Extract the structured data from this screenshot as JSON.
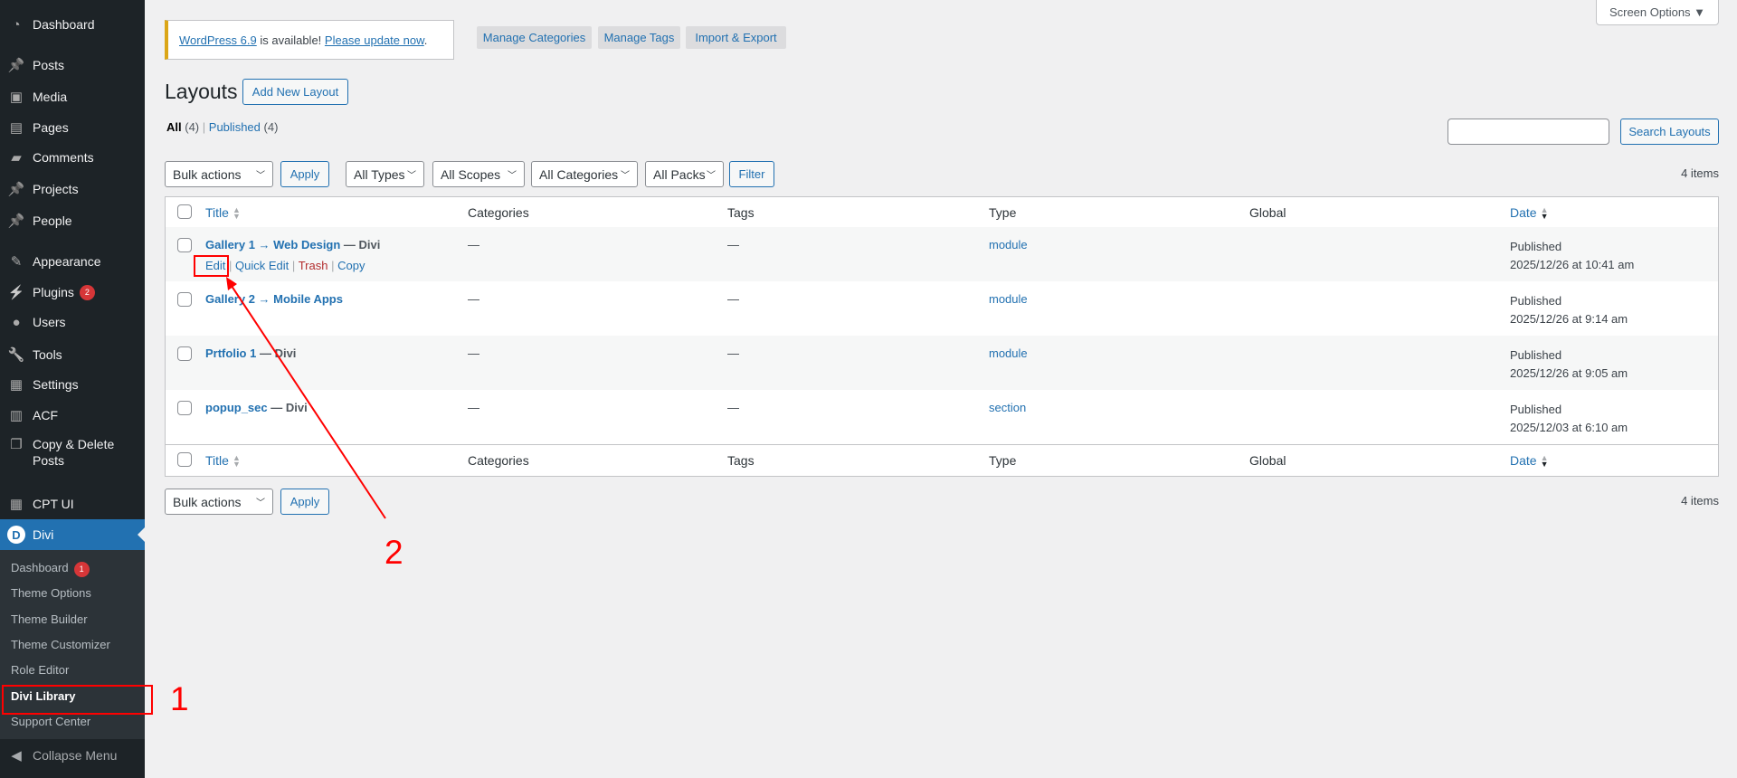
{
  "sidebar": {
    "items": [
      {
        "label": "Dashboard",
        "icon": "dashboard-icon"
      },
      {
        "label": "Posts",
        "icon": "pin-icon"
      },
      {
        "label": "Media",
        "icon": "media-icon"
      },
      {
        "label": "Pages",
        "icon": "pages-icon"
      },
      {
        "label": "Comments",
        "icon": "comment-icon"
      },
      {
        "label": "Projects",
        "icon": "pin-icon"
      },
      {
        "label": "People",
        "icon": "pin-icon"
      },
      {
        "label": "Appearance",
        "icon": "brush-icon"
      },
      {
        "label": "Plugins",
        "icon": "plugin-icon",
        "badge": "2"
      },
      {
        "label": "Users",
        "icon": "user-icon"
      },
      {
        "label": "Tools",
        "icon": "wrench-icon"
      },
      {
        "label": "Settings",
        "icon": "settings-icon"
      },
      {
        "label": "ACF",
        "icon": "acf-icon"
      },
      {
        "label": "Copy & Delete Posts",
        "icon": "copy-icon"
      },
      {
        "label": "CPT UI",
        "icon": "grid-icon"
      }
    ],
    "active": {
      "label": "Divi",
      "icon": "divi-logo-icon"
    },
    "submenu": [
      {
        "label": "Dashboard",
        "badge": "1"
      },
      {
        "label": "Theme Options"
      },
      {
        "label": "Theme Builder"
      },
      {
        "label": "Theme Customizer"
      },
      {
        "label": "Role Editor"
      },
      {
        "label": "Divi Library",
        "current": true
      },
      {
        "label": "Support Center"
      }
    ],
    "collapse": "Collapse Menu"
  },
  "notice": {
    "link1": "WordPress 6.9",
    "text": " is available! ",
    "link2": "Please update now",
    "end": "."
  },
  "top_buttons": [
    "Manage Categories",
    "Manage Tags",
    "Import & Export"
  ],
  "screen_options": "Screen Options ▼",
  "page_title": "Layouts",
  "add_new": "Add New Layout",
  "views": {
    "all": "All",
    "all_count": "(4)",
    "sep": "|",
    "published": "Published",
    "published_count": "(4)"
  },
  "search": {
    "value": "",
    "button": "Search Layouts"
  },
  "filters": {
    "bulk": "Bulk actions",
    "apply": "Apply",
    "types": "All Types",
    "scopes": "All Scopes",
    "categories": "All Categories",
    "packs": "All Packs",
    "filter": "Filter"
  },
  "item_count": "4 items",
  "columns": [
    "Title",
    "Categories",
    "Tags",
    "Type",
    "Global",
    "Date"
  ],
  "row_actions": {
    "edit": "Edit",
    "quick_edit": "Quick Edit",
    "trash": "Trash",
    "copy": "Copy"
  },
  "rows": [
    {
      "title": "Gallery 1 → Web Design",
      "suffix": " — Divi",
      "categories": "—",
      "tags": "—",
      "type": "module",
      "global": "",
      "status": "Published",
      "date": "2025/12/26 at 10:41 am"
    },
    {
      "title": "Gallery 2 → Mobile Apps",
      "suffix": "",
      "categories": "—",
      "tags": "—",
      "type": "module",
      "global": "",
      "status": "Published",
      "date": "2025/12/26 at 9:14 am"
    },
    {
      "title": "Prtfolio 1",
      "suffix": " — Divi",
      "categories": "—",
      "tags": "—",
      "type": "module",
      "global": "",
      "status": "Published",
      "date": "2025/12/26 at 9:05 am"
    },
    {
      "title": "popup_sec",
      "suffix": " — Divi",
      "categories": "—",
      "tags": "—",
      "type": "section",
      "global": "",
      "status": "Published",
      "date": "2025/12/03 at 6:10 am"
    }
  ],
  "annotations": {
    "step1": "1",
    "step2": "2",
    "color": "#ff0000"
  }
}
